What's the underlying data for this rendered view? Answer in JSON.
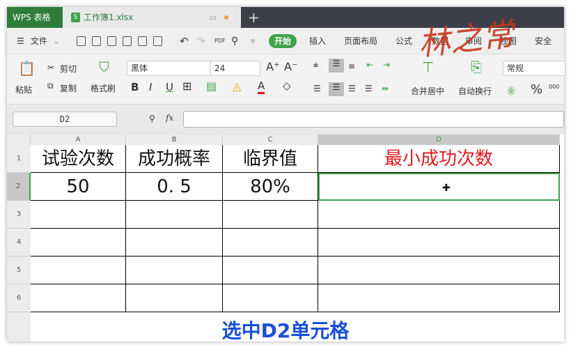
{
  "titlebar": {
    "app_tab": "WPS 表格",
    "doc_tab": "工作簿1.xlsx",
    "new_tab": "+"
  },
  "toolbar": {
    "file_menu": "文件",
    "tabs": [
      "开始",
      "插入",
      "页面布局",
      "公式",
      "数据",
      "审阅",
      "视图",
      "安全"
    ]
  },
  "ribbon": {
    "paste": "粘贴",
    "cut": "剪切",
    "copy": "复制",
    "format_painter": "格式刷",
    "font_name": "黑体",
    "font_size": "24",
    "bold": "B",
    "italic": "I",
    "underline": "U",
    "merge_center": "合并居中",
    "wrap_text": "自动换行",
    "number_format": "常规",
    "percent": "%",
    "thousands": "000"
  },
  "formula_bar": {
    "name_box": "D2",
    "fx": "fx",
    "formula": ""
  },
  "sheet": {
    "columns": [
      "A",
      "B",
      "C",
      "D"
    ],
    "rows": [
      "1",
      "2",
      "3",
      "4",
      "5",
      "6"
    ],
    "cells": [
      [
        "试验次数",
        "成功概率",
        "临界值",
        "最小成功次数"
      ],
      [
        "50",
        "0. 5",
        "80%",
        ""
      ]
    ]
  },
  "caption": "选中D2单元格",
  "watermark": "林之常",
  "colors": {
    "accent": "#3fa24a",
    "header_red": "#e0181e",
    "caption_blue": "#1a4fd6",
    "selection": "#3fa24a"
  }
}
